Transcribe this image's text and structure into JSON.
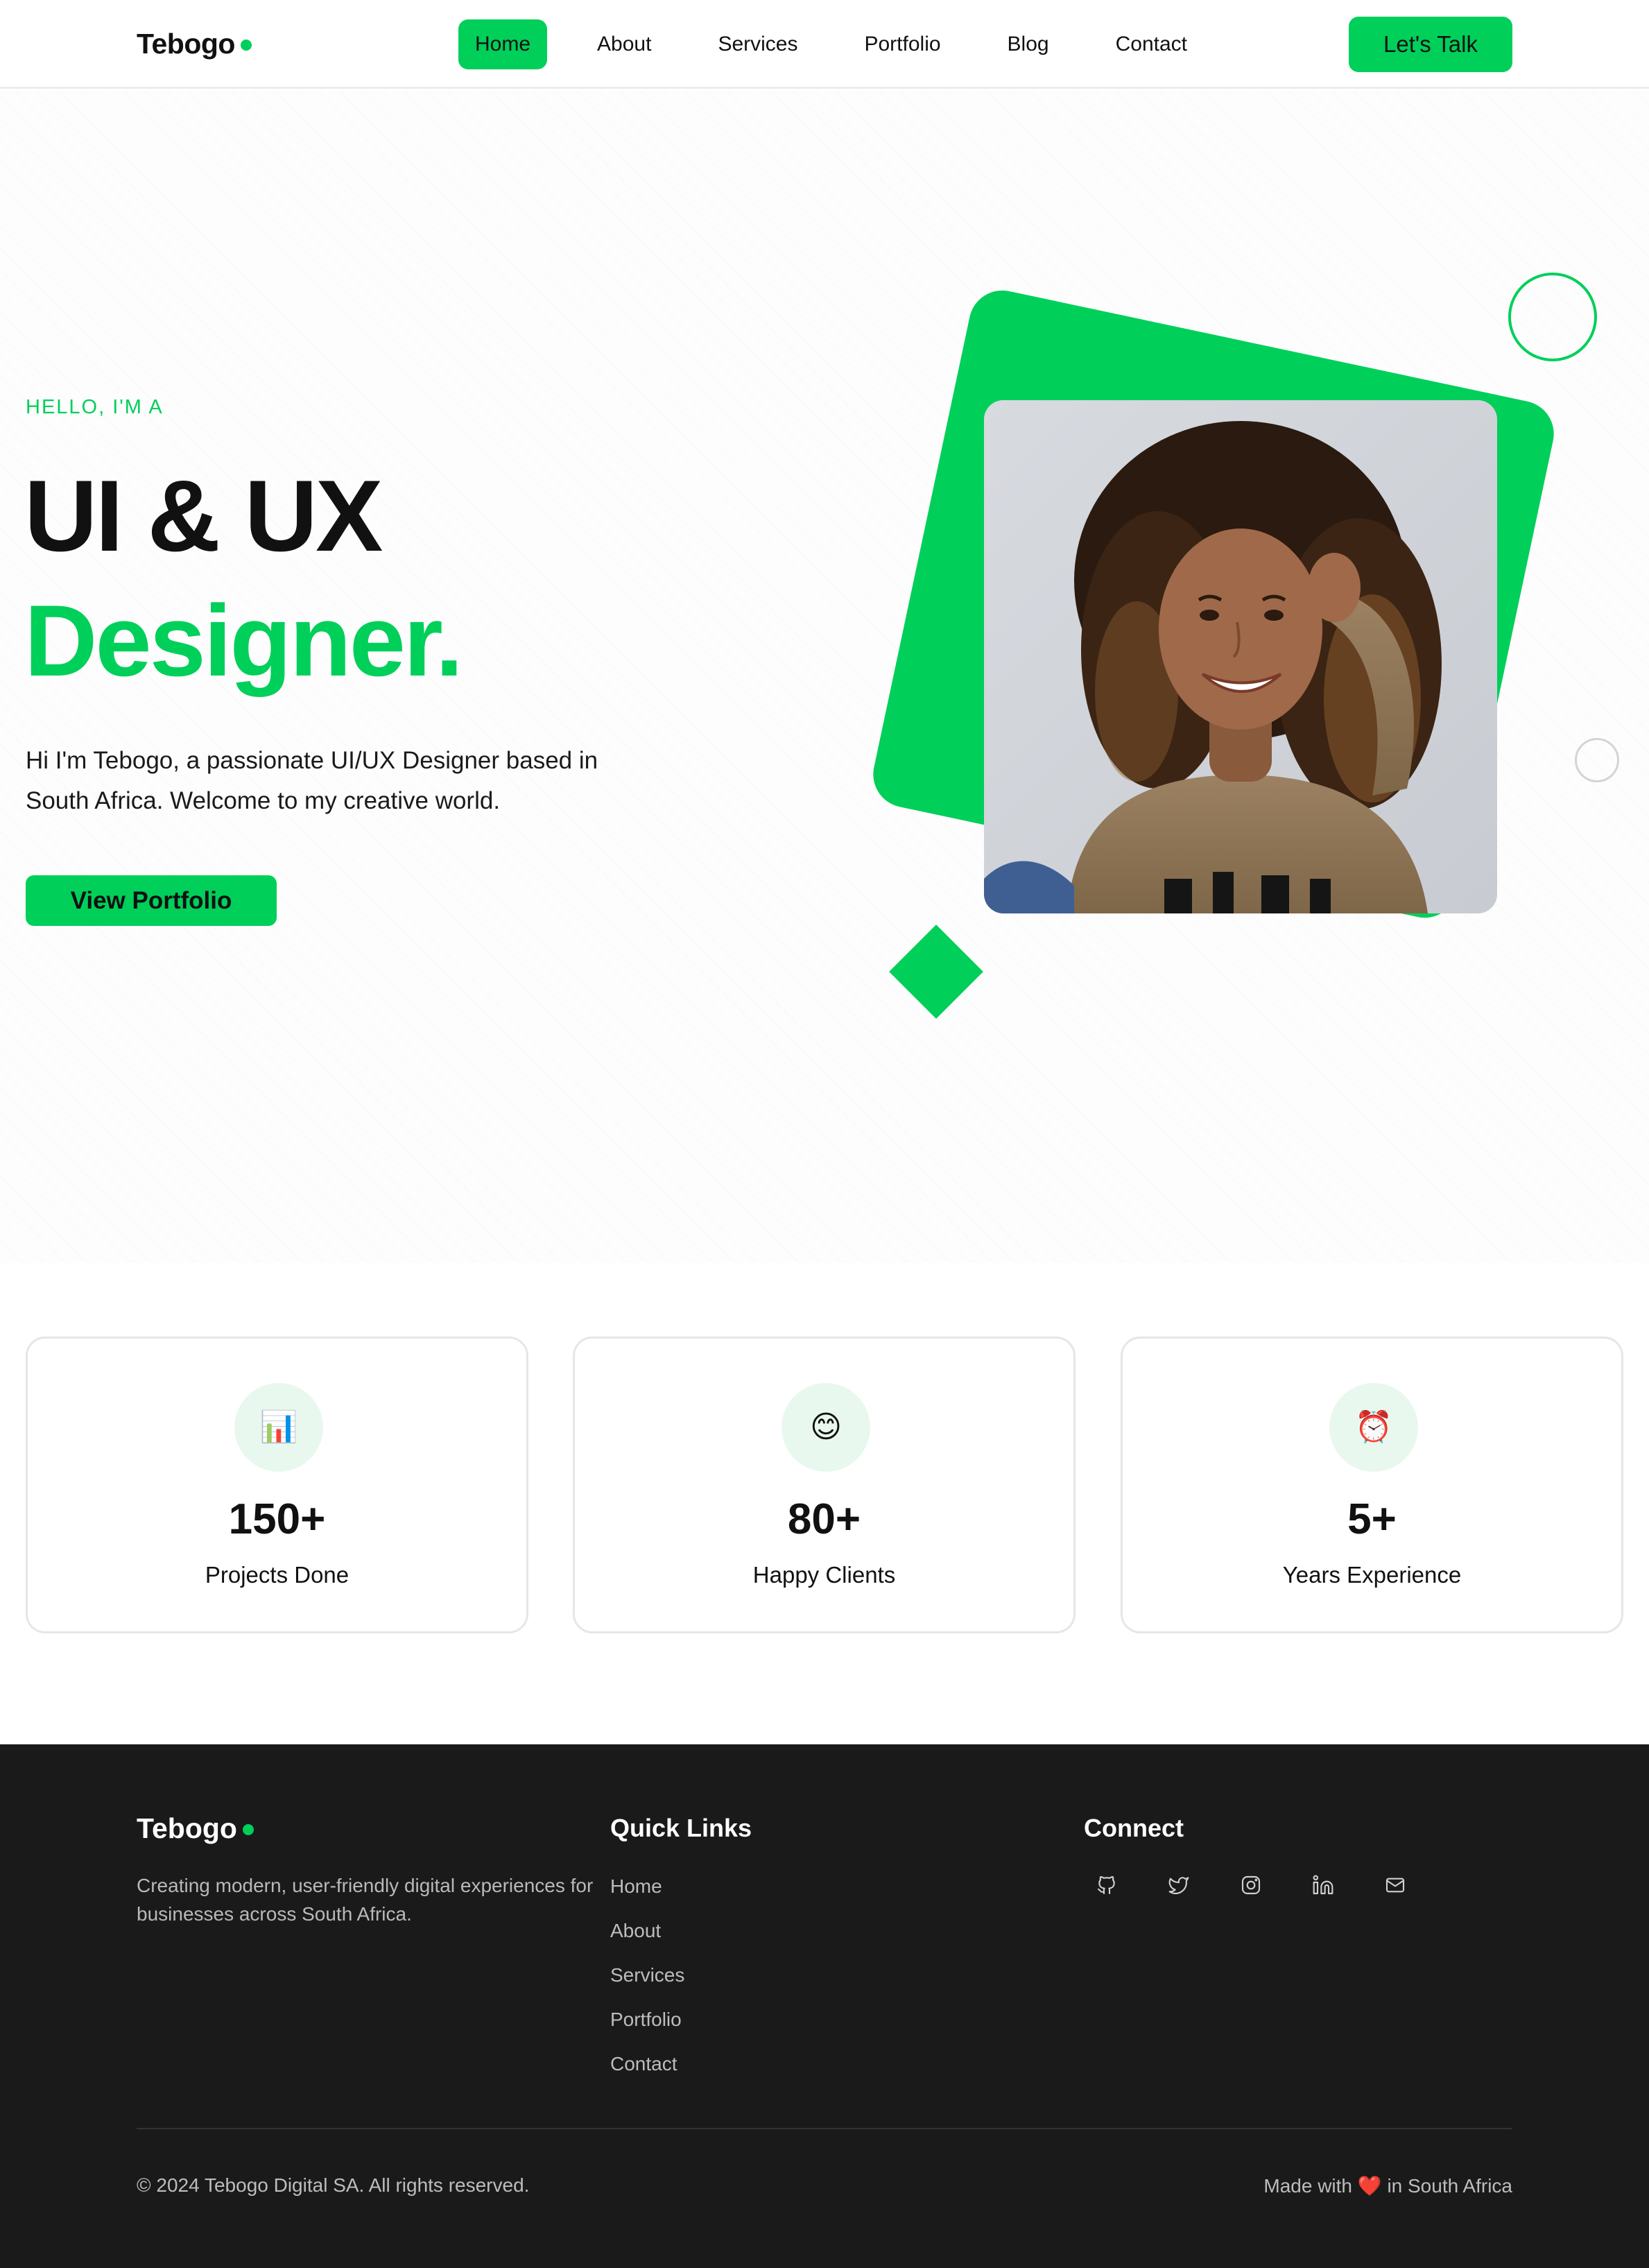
{
  "brand": {
    "name": "Tebogo",
    "accent_color": "#00cf5a"
  },
  "nav": {
    "items": [
      {
        "label": "Home",
        "active": true
      },
      {
        "label": "About",
        "active": false
      },
      {
        "label": "Services",
        "active": false
      },
      {
        "label": "Portfolio",
        "active": false
      },
      {
        "label": "Blog",
        "active": false
      },
      {
        "label": "Contact",
        "active": false
      }
    ],
    "cta_label": "Let's Talk"
  },
  "hero": {
    "eyebrow": "HELLO, I'M A",
    "title_line1": "UI & UX",
    "title_line2": "Designer.",
    "description": "Hi I'm Tebogo, a passionate UI/UX Designer based in South Africa. Welcome to my creative world.",
    "button_label": "View Portfolio",
    "portrait_icon": "portrait-photo"
  },
  "stats": [
    {
      "icon": "📊",
      "icon_name": "bar-chart-icon",
      "value": "150+",
      "label": "Projects Done"
    },
    {
      "icon": "😊",
      "icon_name": "smiley-icon",
      "value": "80+",
      "label": "Happy Clients"
    },
    {
      "icon": "⏰",
      "icon_name": "alarm-clock-icon",
      "value": "5+",
      "label": "Years Experience"
    }
  ],
  "footer": {
    "brand": "Tebogo",
    "description": "Creating modern, user-friendly digital experiences for businesses across South Africa.",
    "quick_links_heading": "Quick Links",
    "quick_links": [
      "Home",
      "About",
      "Services",
      "Portfolio",
      "Contact"
    ],
    "connect_heading": "Connect",
    "socials": [
      "github-icon",
      "twitter-icon",
      "instagram-icon",
      "linkedin-icon",
      "mail-icon"
    ],
    "copyright": "© 2024 Tebogo Digital SA. All rights reserved.",
    "made_with_prefix": "Made with",
    "made_with_heart": "❤️",
    "made_with_suffix": "in South Africa"
  }
}
